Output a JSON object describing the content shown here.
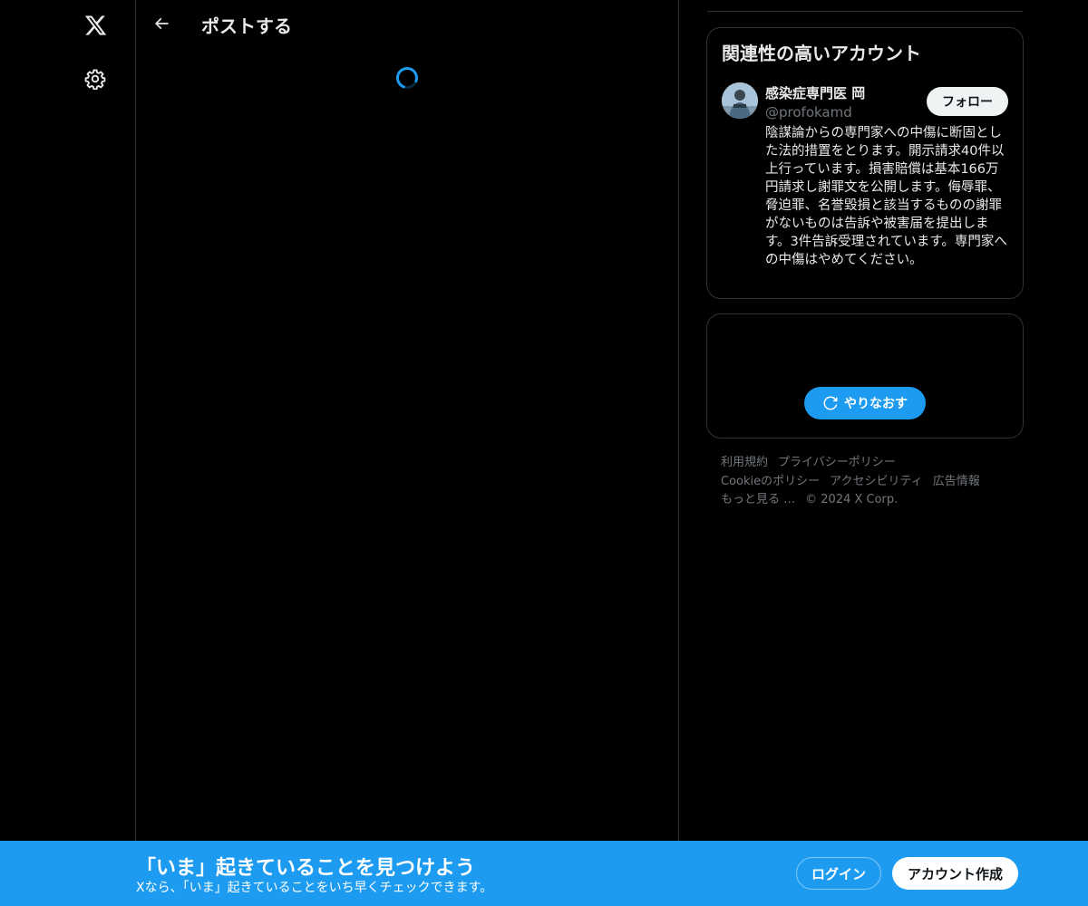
{
  "nav": {
    "logo_icon": "x-logo-icon",
    "settings_icon": "gear-icon"
  },
  "main": {
    "back_icon": "arrow-left-icon",
    "title": "ポストする",
    "loading_icon": "spinner-icon"
  },
  "sidebar": {
    "related": {
      "title": "関連性の高いアカウント",
      "account": {
        "name": "感染症専門医 岡",
        "handle": "@profokamd",
        "bio": "陰謀論からの専門家への中傷に断固とした法的措置をとります。開示請求40件以上行っています。損害賠償は基本166万円請求し謝罪文を公開します。侮辱罪、脅迫罪、名誉毀損と該当するものの謝罪がないものは告訴や被害届を提出します。3件告訴受理されています。専門家への中傷はやめてください。",
        "follow_label": "フォロー"
      }
    },
    "retry": {
      "label": "やりなおす",
      "icon": "refresh-icon"
    },
    "footer": {
      "terms": "利用規約",
      "privacy": "プライバシーポリシー",
      "cookie": "Cookieのポリシー",
      "accessibility": "アクセシビリティ",
      "ads": "広告情報",
      "more": "もっと見る …",
      "copyright": "© 2024 X Corp."
    }
  },
  "banner": {
    "title": "「いま」起きていることを見つけよう",
    "subtitle": "Xなら、「いま」起きていることをいち早くチェックできます。",
    "login_label": "ログイン",
    "signup_label": "アカウント作成"
  },
  "colors": {
    "accent": "#1d9bf0",
    "background": "#000000",
    "border": "#2f3336",
    "text_primary": "#e7e9ea",
    "text_secondary": "#71767b"
  }
}
